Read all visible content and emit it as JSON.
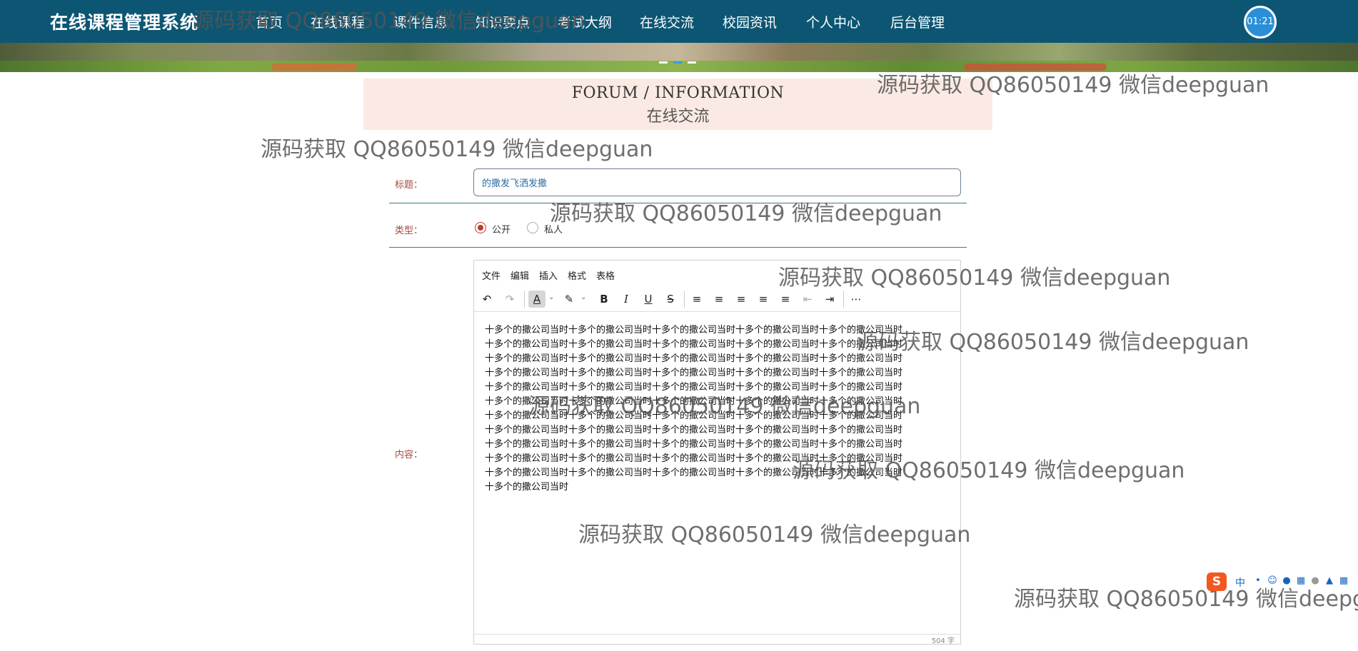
{
  "app": {
    "brand": "在线课程管理系统"
  },
  "nav": {
    "items": [
      "首页",
      "在线课程",
      "课件信息",
      "知识要点",
      "考试大纲",
      "在线交流",
      "校园资讯",
      "个人中心",
      "后台管理"
    ],
    "active": "在线交流",
    "avatar_label": "01:21"
  },
  "section": {
    "title_en": "FORUM / INFORMATION",
    "title_cn": "在线交流"
  },
  "form": {
    "title_label": "标题：",
    "title_value": "的撒发飞洒发撒",
    "type_label": "类型：",
    "type_options": [
      "公开",
      "私人"
    ],
    "type_selected": "公开",
    "content_label": "内容："
  },
  "editor": {
    "menu": [
      "文件",
      "编辑",
      "插入",
      "格式",
      "表格"
    ],
    "toolbar_icons": [
      "undo-icon",
      "redo-icon",
      "text-color-icon",
      "highlight-icon",
      "bold-icon",
      "italic-icon",
      "underline-icon",
      "strikethrough-icon",
      "line-height-icon",
      "align-left-icon",
      "align-center-icon",
      "align-right-icon",
      "align-justify-icon",
      "outdent-icon",
      "indent-icon",
      "more-icon"
    ],
    "content_lines": [
      "十多个的撒公司当时十多个的撒公司当时十多个的撒公司当时十多个的撒公司当时十多个的撒公司当时",
      "十多个的撒公司当时十多个的撒公司当时十多个的撒公司当时十多个的撒公司当时十多个的撒公司当时",
      "十多个的撒公司当时十多个的撒公司当时十多个的撒公司当时十多个的撒公司当时十多个的撒公司当时",
      "十多个的撒公司当时十多个的撒公司当时十多个的撒公司当时十多个的撒公司当时十多个的撒公司当时",
      "十多个的撒公司当时十多个的撒公司当时十多个的撒公司当时十多个的撒公司当时十多个的撒公司当时",
      "十多个的撒公司当时十多个的撒公司当时十多个的撒公司当时十多个的撒公司当时十多个的撒公司当时",
      "十多个的撒公司当时十多个的撒公司当时十多个的撒公司当时十多个的撒公司当时十多个的撒公司当时",
      "十多个的撒公司当时十多个的撒公司当时十多个的撒公司当时十多个的撒公司当时十多个的撒公司当时",
      "十多个的撒公司当时十多个的撒公司当时十多个的撒公司当时十多个的撒公司当时十多个的撒公司当时",
      "十多个的撒公司当时十多个的撒公司当时十多个的撒公司当时十多个的撒公司当时十多个的撒公司当时",
      "十多个的撒公司当时十多个的撒公司当时十多个的撒公司当时十多个的撒公司当时十多个的撒公司当时",
      "十多个的撒公司当时"
    ],
    "word_count": "504 字"
  },
  "watermark": {
    "text": "源码获取 QQ86050149 微信deepguan",
    "text_clipped": "源码获取 QQ86050149 微信deepg"
  },
  "ime": {
    "logo": "S",
    "lang": "中"
  }
}
